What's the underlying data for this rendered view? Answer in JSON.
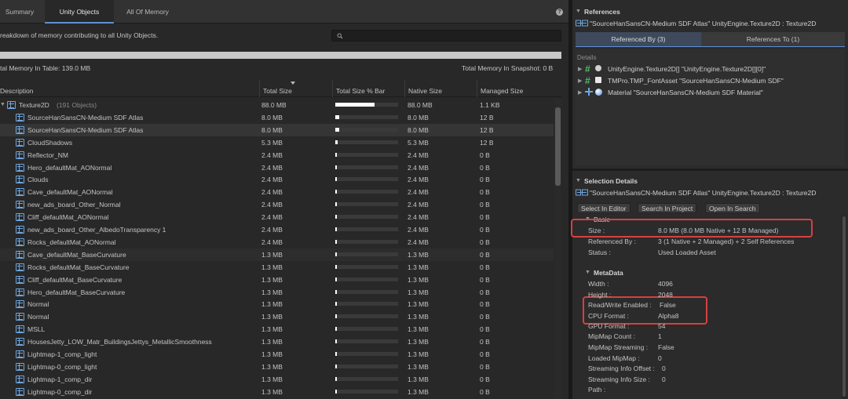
{
  "tabs": [
    {
      "label": "Summary"
    },
    {
      "label": "Unity Objects"
    },
    {
      "label": "All Of Memory"
    }
  ],
  "help_icon": "?",
  "description": "reakdown of memory contributing to all Unity Objects.",
  "search": {
    "value": "",
    "placeholder": ""
  },
  "totals": {
    "in_table": "tal Memory In Table: 139.0 MB",
    "in_snapshot": "Total Memory In Snapshot: 0 B"
  },
  "columns": [
    "Description",
    "Total Size",
    "Total Size % Bar",
    "Native Size",
    "Managed Size"
  ],
  "group": {
    "name": "Texture2D",
    "count": "(191 Objects)",
    "total": "88.0 MB",
    "pct": 0.62,
    "native": "88.0 MB",
    "managed": "1.1 KB"
  },
  "rows": [
    {
      "name": "SourceHanSansCN-Medium SDF Atlas",
      "total": "8.0 MB",
      "pct": 0.06,
      "native": "8.0 MB",
      "managed": "12 B"
    },
    {
      "name": "SourceHanSansCN-Medium SDF Atlas",
      "total": "8.0 MB",
      "pct": 0.06,
      "native": "8.0 MB",
      "managed": "12 B"
    },
    {
      "name": "CloudShadows",
      "total": "5.3 MB",
      "pct": 0.04,
      "native": "5.3 MB",
      "managed": "12 B"
    },
    {
      "name": "Reflector_NM",
      "total": "2.4 MB",
      "pct": 0.02,
      "native": "2.4 MB",
      "managed": "0 B"
    },
    {
      "name": "Hero_defaultMat_AONormal",
      "total": "2.4 MB",
      "pct": 0.02,
      "native": "2.4 MB",
      "managed": "0 B"
    },
    {
      "name": "Clouds",
      "total": "2.4 MB",
      "pct": 0.02,
      "native": "2.4 MB",
      "managed": "0 B"
    },
    {
      "name": "Cave_defaultMat_AONormal",
      "total": "2.4 MB",
      "pct": 0.02,
      "native": "2.4 MB",
      "managed": "0 B"
    },
    {
      "name": "new_ads_board_Other_Normal",
      "total": "2.4 MB",
      "pct": 0.02,
      "native": "2.4 MB",
      "managed": "0 B"
    },
    {
      "name": "Cliff_defaultMat_AONormal",
      "total": "2.4 MB",
      "pct": 0.02,
      "native": "2.4 MB",
      "managed": "0 B"
    },
    {
      "name": "new_ads_board_Other_AlbedoTransparency 1",
      "total": "2.4 MB",
      "pct": 0.02,
      "native": "2.4 MB",
      "managed": "0 B"
    },
    {
      "name": "Rocks_defaultMat_AONormal",
      "total": "2.4 MB",
      "pct": 0.02,
      "native": "2.4 MB",
      "managed": "0 B"
    },
    {
      "name": "Cave_defaultMat_BaseCurvature",
      "total": "1.3 MB",
      "pct": 0.01,
      "native": "1.3 MB",
      "managed": "0 B"
    },
    {
      "name": "Rocks_defaultMat_BaseCurvature",
      "total": "1.3 MB",
      "pct": 0.01,
      "native": "1.3 MB",
      "managed": "0 B"
    },
    {
      "name": "Cliff_defaultMat_BaseCurvature",
      "total": "1.3 MB",
      "pct": 0.01,
      "native": "1.3 MB",
      "managed": "0 B"
    },
    {
      "name": "Hero_defaultMat_BaseCurvature",
      "total": "1.3 MB",
      "pct": 0.01,
      "native": "1.3 MB",
      "managed": "0 B"
    },
    {
      "name": "Normal",
      "total": "1.3 MB",
      "pct": 0.01,
      "native": "1.3 MB",
      "managed": "0 B"
    },
    {
      "name": "Normal",
      "total": "1.3 MB",
      "pct": 0.01,
      "native": "1.3 MB",
      "managed": "0 B"
    },
    {
      "name": "MSLL",
      "total": "1.3 MB",
      "pct": 0.01,
      "native": "1.3 MB",
      "managed": "0 B"
    },
    {
      "name": "HousesJetty_LOW_Matr_BuildingsJettys_MetallicSmoothness",
      "total": "1.3 MB",
      "pct": 0.01,
      "native": "1.3 MB",
      "managed": "0 B"
    },
    {
      "name": "Lightmap-1_comp_light",
      "total": "1.3 MB",
      "pct": 0.01,
      "native": "1.3 MB",
      "managed": "0 B"
    },
    {
      "name": "Lightmap-0_comp_light",
      "total": "1.3 MB",
      "pct": 0.01,
      "native": "1.3 MB",
      "managed": "0 B"
    },
    {
      "name": "Lightmap-1_comp_dir",
      "total": "1.3 MB",
      "pct": 0.01,
      "native": "1.3 MB",
      "managed": "0 B"
    },
    {
      "name": "Lightmap-0_comp_dir",
      "total": "1.3 MB",
      "pct": 0.01,
      "native": "1.3 MB",
      "managed": "0 B"
    }
  ],
  "references": {
    "title": "References",
    "object": "\"SourceHanSansCN-Medium SDF Atlas\" UnityEngine.Texture2D : Texture2D",
    "tab_by": "Referenced By (3)",
    "tab_to": "References To (1)",
    "details_label": "Details",
    "items": [
      "UnityEngine.Texture2D[] \"UnityEngine.Texture2D[][0]\"",
      "TMPro.TMP_FontAsset \"SourceHanSansCN-Medium SDF\"",
      "Material \"SourceHanSansCN-Medium SDF Material\""
    ]
  },
  "selection": {
    "title": "Selection Details",
    "object": "\"SourceHanSansCN-Medium SDF Atlas\" UnityEngine.Texture2D : Texture2D",
    "buttons": [
      "Select In Editor",
      "Search In Project",
      "Open In Search"
    ],
    "basic_label": "Basic",
    "basic": [
      {
        "key": "Size :",
        "val": "8.0 MB (8.0 MB Native + 12 B Managed)"
      },
      {
        "key": "Referenced By :",
        "val": "3 (1 Native + 2 Managed) + 2 Self References"
      },
      {
        "key": "Status :",
        "val": "Used Loaded Asset"
      }
    ],
    "meta_label": "MetaData",
    "meta": [
      {
        "key": "Width :",
        "val": "4096"
      },
      {
        "key": "Height :",
        "val": "2048"
      },
      {
        "key": "Read/Write Enabled :",
        "val": "False"
      },
      {
        "key": "CPU Format :",
        "val": "Alpha8"
      },
      {
        "key": "GPU Format :",
        "val": "54"
      },
      {
        "key": "MipMap Count :",
        "val": "1"
      },
      {
        "key": "MipMap Streaming :",
        "val": "False"
      },
      {
        "key": "Loaded MipMap :",
        "val": "0"
      },
      {
        "key": "Streaming Info Offset :",
        "val": "0"
      },
      {
        "key": "Streaming Info Size :",
        "val": "0"
      },
      {
        "key": "Path :",
        "val": ""
      }
    ]
  },
  "colors": {
    "accent": "#5d8fd6",
    "highlight": "#d84040",
    "texture_icon": "#6fa6df"
  }
}
